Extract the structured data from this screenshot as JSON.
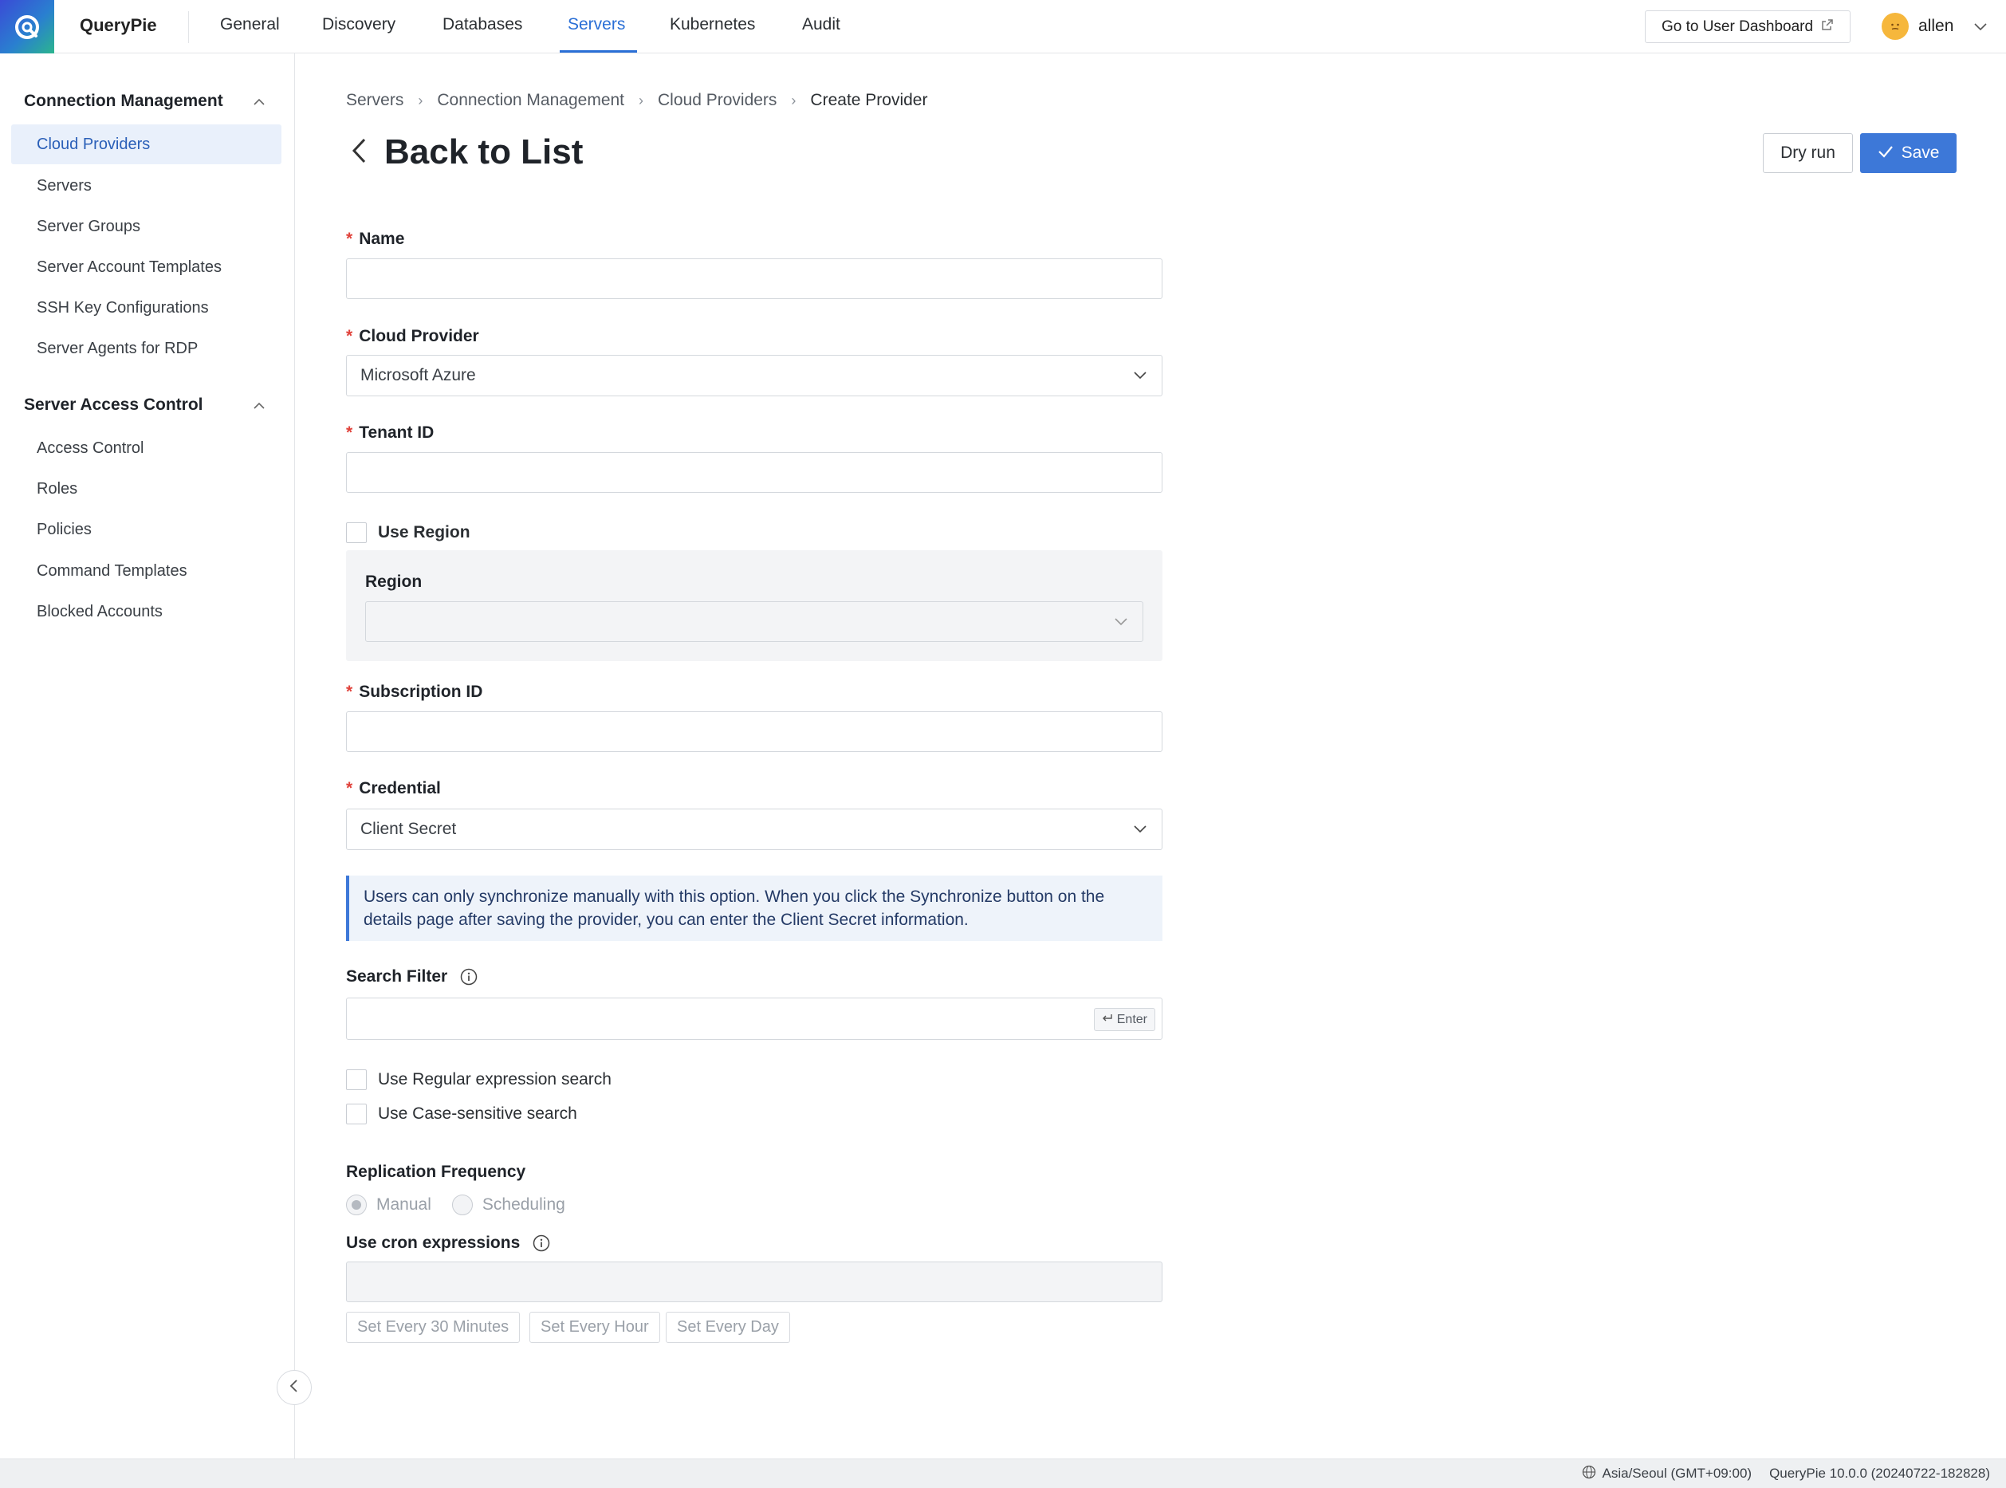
{
  "topnav": {
    "brand": "QueryPie",
    "tabs": [
      {
        "label": "General"
      },
      {
        "label": "Discovery"
      },
      {
        "label": "Databases"
      },
      {
        "label": "Servers"
      },
      {
        "label": "Kubernetes"
      },
      {
        "label": "Audit"
      }
    ],
    "active_tab": "Servers",
    "dashboard_button": "Go to User Dashboard",
    "user_name": "allen"
  },
  "sidebar": {
    "groups": [
      {
        "title": "Connection Management",
        "items": [
          {
            "label": "Cloud Providers"
          },
          {
            "label": "Servers"
          },
          {
            "label": "Server Groups"
          },
          {
            "label": "Server Account Templates"
          },
          {
            "label": "SSH Key Configurations"
          },
          {
            "label": "Server Agents for RDP"
          }
        ]
      },
      {
        "title": "Server Access Control",
        "items": [
          {
            "label": "Access Control"
          },
          {
            "label": "Roles"
          },
          {
            "label": "Policies"
          },
          {
            "label": "Command Templates"
          },
          {
            "label": "Blocked Accounts"
          }
        ]
      }
    ],
    "active_item": "Cloud Providers"
  },
  "breadcrumb": [
    "Servers",
    "Connection Management",
    "Cloud Providers",
    "Create Provider"
  ],
  "page_title": "Back to List",
  "actions": {
    "dry_run": "Dry run",
    "save": "Save"
  },
  "form": {
    "name": {
      "label": "Name",
      "value": ""
    },
    "cloud_provider": {
      "label": "Cloud Provider",
      "value": "Microsoft Azure"
    },
    "tenant_id": {
      "label": "Tenant ID",
      "value": ""
    },
    "use_region": {
      "label": "Use Region",
      "checked": false
    },
    "region": {
      "label": "Region",
      "value": ""
    },
    "subscription_id": {
      "label": "Subscription ID",
      "value": ""
    },
    "credential": {
      "label": "Credential",
      "value": "Client Secret"
    },
    "credential_notice": "Users can only synchronize manually with this option. When you click the Synchronize button on the details page after saving the provider, you can enter the Client Secret information.",
    "search_filter": {
      "label": "Search Filter",
      "value": "",
      "enter_hint": "Enter"
    },
    "use_regex": {
      "label": "Use Regular expression search",
      "checked": false
    },
    "use_case_sensitive": {
      "label": "Use Case-sensitive search",
      "checked": false
    },
    "replication_frequency": {
      "label": "Replication Frequency",
      "options": [
        "Manual",
        "Scheduling"
      ],
      "selected": "Manual"
    },
    "cron": {
      "label": "Use cron expressions",
      "value": "",
      "presets": [
        "Set Every 30 Minutes",
        "Set Every Hour",
        "Set Every Day"
      ]
    }
  },
  "footer": {
    "timezone": "Asia/Seoul (GMT+09:00)",
    "version": "QueryPie 10.0.0 (20240722-182828)"
  },
  "colors": {
    "accent": "#3d78d8",
    "required": "#e0413a",
    "active_nav": "#2a6fd6"
  }
}
